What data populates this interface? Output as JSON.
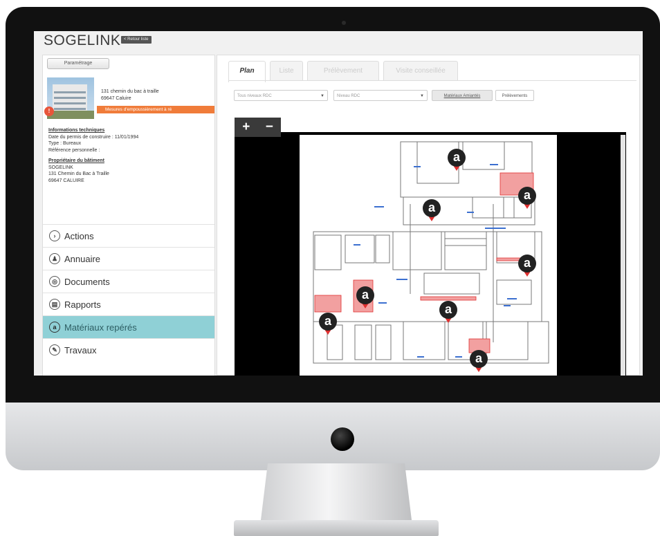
{
  "app": {
    "brand": "SOGELINK",
    "status_button": "< Retour liste"
  },
  "sidebar": {
    "param_button": "Paramétrage",
    "address_line1": "131 chemin du bac à traille",
    "address_line2": "69647 Caluire",
    "alert_badge": "!",
    "alert_banner": "Mesures d'empoussièrement à ré",
    "tech_heading": "Informations techniques",
    "tech_permit": "Date du permis de construire : 11/01/1994",
    "tech_type": "Type : Bureaux",
    "tech_ref": "Référence personnelle :",
    "owner_heading": "Propriétaire du bâtiment",
    "owner_name": "SOGELINK",
    "owner_street": "131 Chemin du Bac à Traille",
    "owner_city": "69647 CALUIRE",
    "menu": [
      {
        "label": "Actions",
        "icon": "chevron-right-icon",
        "glyph": "›"
      },
      {
        "label": "Annuaire",
        "icon": "contacts-icon",
        "glyph": "♟"
      },
      {
        "label": "Documents",
        "icon": "documents-icon",
        "glyph": "◎"
      },
      {
        "label": "Rapports",
        "icon": "reports-icon",
        "glyph": "▤"
      },
      {
        "label": "Matériaux repérés",
        "icon": "materials-icon",
        "glyph": "a"
      },
      {
        "label": "Travaux",
        "icon": "works-icon",
        "glyph": "✎"
      }
    ],
    "active_menu_index": 4
  },
  "main": {
    "tabs": [
      "Plan",
      "Liste",
      "Prélèvement",
      "Visite conseillée"
    ],
    "active_tab_index": 0,
    "filters": {
      "select1": "Tous niveaux RDC",
      "select2": "Niveau RDC",
      "toggle_on": "Matériaux Amiantés",
      "toggle_off": "Prélèvements"
    },
    "zoom_in": "+",
    "zoom_out": "−",
    "marker_glyph": "a",
    "marker_count": 9
  },
  "colors": {
    "accent_active": "#8fd0d6",
    "alert_orange": "#f07c3a",
    "marker_red": "#e03030",
    "zone_red": "#f2a0a0"
  }
}
